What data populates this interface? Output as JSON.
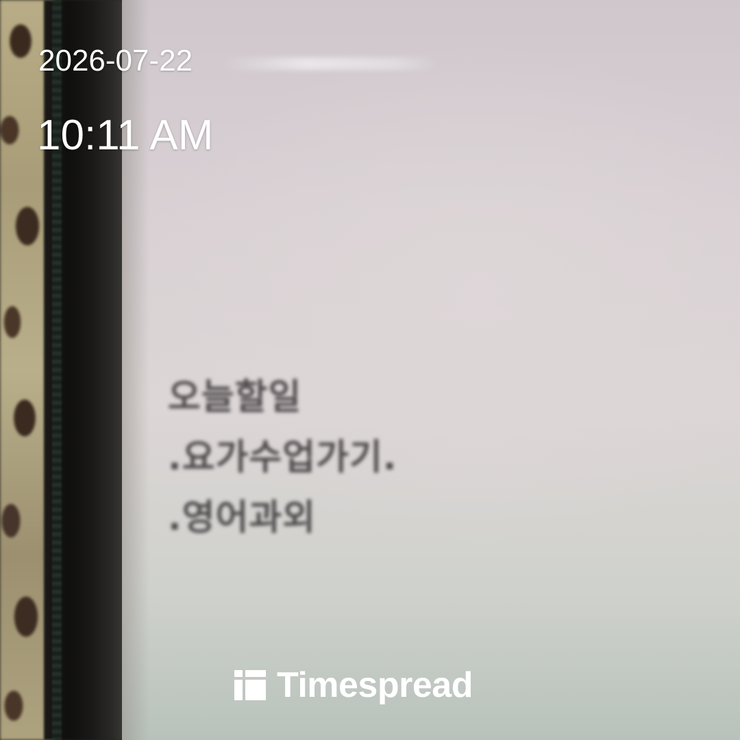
{
  "overlay": {
    "date": "2026-07-22",
    "time": "10:11 AM"
  },
  "note": {
    "lines": [
      "오늘할일",
      ".요가수업가기.",
      ".영어과외"
    ]
  },
  "brand": {
    "name": "Timespread",
    "icon": "timespread-logo-icon"
  }
}
